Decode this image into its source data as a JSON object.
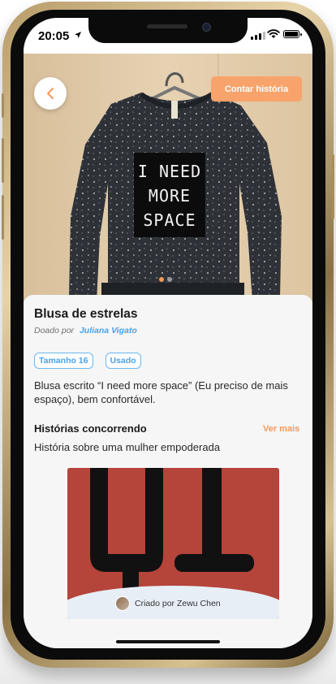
{
  "status_bar": {
    "time": "20:05"
  },
  "hero": {
    "shirt_text": [
      "I NEED",
      "MORE",
      "SPACE"
    ],
    "carousel_total": 2,
    "carousel_active": 1
  },
  "header": {
    "contar_label": "Contar história"
  },
  "item": {
    "title": "Blusa de estrelas",
    "donated_by_label": "Doado por",
    "donor_name": "Juliana Vigato",
    "tags": [
      "Tamanho 16",
      "Usado"
    ],
    "description": "Blusa escrito “I need more space” (Eu preciso de mais espaço), bem confortável."
  },
  "stories": {
    "heading": "Histórias concorrendo",
    "see_more_label": "Ver mais",
    "story_title": "História sobre uma mulher empoderada",
    "card": {
      "creator_text": "Criado por Zewu Chen"
    }
  },
  "colors": {
    "accent_orange": "#f39a5d",
    "accent_blue": "#4aa3e6",
    "story_card_bg": "#b5443a"
  }
}
